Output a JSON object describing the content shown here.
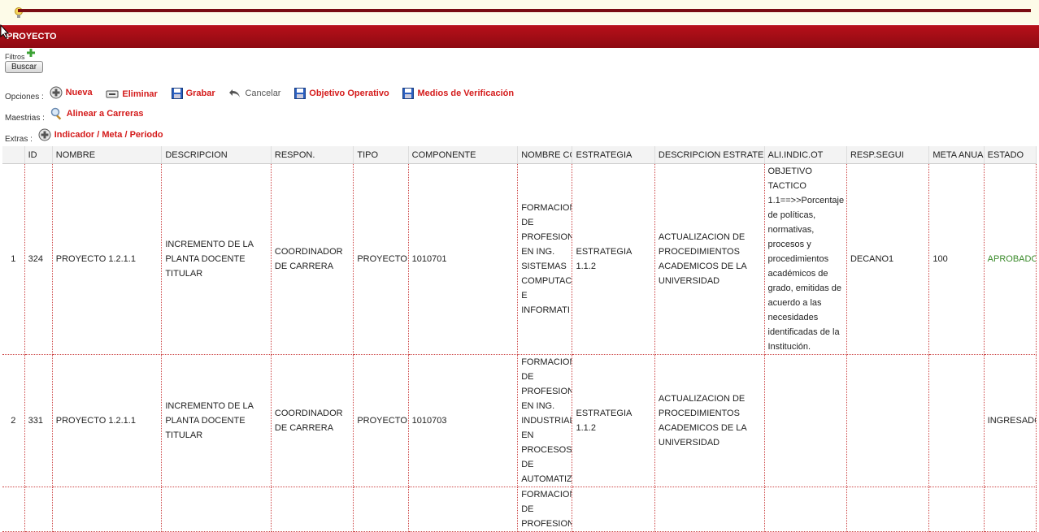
{
  "header": {
    "title": "PROYECTO"
  },
  "filters": {
    "label": "Filtros",
    "search_button": "Buscar"
  },
  "options": {
    "label": "Opciones :",
    "actions": [
      {
        "label": "Nueva",
        "icon": "plus-circle-icon"
      },
      {
        "label": "Eliminar",
        "icon": "minus-box-icon"
      },
      {
        "label": "Grabar",
        "icon": "save-icon"
      },
      {
        "label": "Cancelar",
        "icon": "undo-icon"
      },
      {
        "label": "Objetivo Operativo",
        "icon": "save-icon"
      },
      {
        "label": "Medios de Verificación",
        "icon": "save-icon"
      }
    ]
  },
  "maestrias": {
    "label": "Maestrias :",
    "action": "Alinear a Carreras",
    "icon": "search-icon"
  },
  "extras": {
    "label": "Extras :",
    "action": "Indicador / Meta / Periodo",
    "icon": "plus-circle-icon"
  },
  "table": {
    "columns": [
      "",
      "ID",
      "NOMBRE",
      "DESCRIPCION",
      "RESPON.",
      "TIPO",
      "COMPONENTE",
      "NOMBRE CO",
      "ESTRATEGIA",
      "DESCRIPCION ESTRATE",
      "ALI.INDIC.OT",
      "RESP.SEGUI",
      "META ANUA",
      "ESTADO"
    ],
    "rows": [
      {
        "rn": "1",
        "id": "324",
        "nombre": "PROYECTO 1.2.1.1",
        "descripcion": "INCREMENTO DE LA PLANTA DOCENTE TITULAR",
        "respon": "COORDINADOR DE CARRERA",
        "tipo": "PROYECTO",
        "componente": "1010701",
        "nombre_co": "FORMACION DE PROFESION EN ING. SISTEMAS COMPUTAC E INFORMATI",
        "estrategia": "ESTRATEGIA 1.1.2",
        "desc_estrategia": "ACTUALIZACION DE PROCEDIMIENTOS ACADEMICOS DE LA UNIVERSIDAD",
        "ali_indic": "OBJETIVO TACTICO 1.1==>>Porcentaje de políticas, normativas, procesos y procedimientos académicos de grado, emitidas de acuerdo a las necesidades identificadas de la Institución.",
        "resp_segui": "DECANO1",
        "meta": "100",
        "estado": "APROBADO"
      },
      {
        "rn": "2",
        "id": "331",
        "nombre": "PROYECTO 1.2.1.1",
        "descripcion": "INCREMENTO DE LA PLANTA DOCENTE TITULAR",
        "respon": "COORDINADOR DE CARRERA",
        "tipo": "PROYECTO",
        "componente": "1010703",
        "nombre_co": "FORMACION DE PROFESION EN ING. INDUSTRIAL EN PROCESOS DE AUTOMATIZ",
        "estrategia": "ESTRATEGIA 1.1.2",
        "desc_estrategia": "ACTUALIZACION DE PROCEDIMIENTOS ACADEMICOS DE LA UNIVERSIDAD",
        "ali_indic": "",
        "resp_segui": "",
        "meta": "",
        "estado": "INGRESADO"
      },
      {
        "rn": "",
        "id": "",
        "nombre": "",
        "descripcion": "",
        "respon": "",
        "tipo": "",
        "componente": "",
        "nombre_co": "FORMACION DE PROFESION",
        "estrategia": "",
        "desc_estrategia": "",
        "ali_indic": "",
        "resp_segui": "",
        "meta": "",
        "estado": ""
      }
    ]
  },
  "colors": {
    "header_bg": "#a30e16",
    "action_red": "#d41a1a",
    "status_green": "#3a8a2a"
  }
}
